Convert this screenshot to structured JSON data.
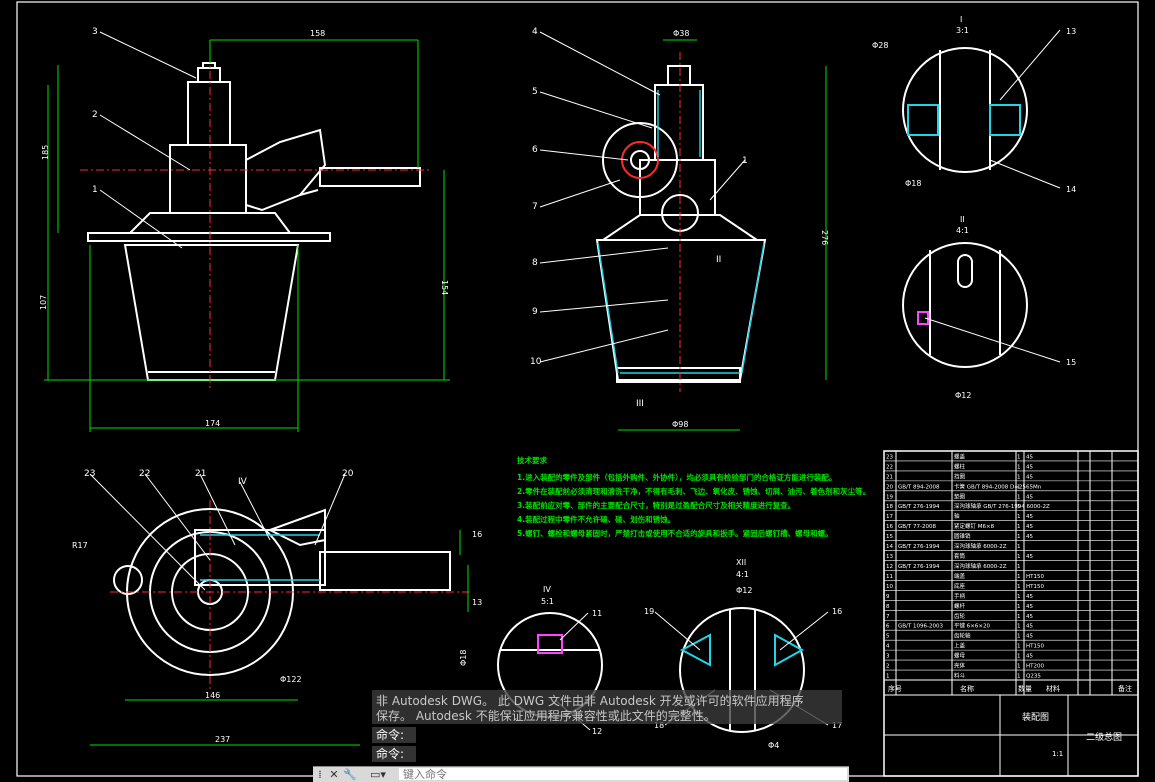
{
  "drawing": {
    "dimensions": {
      "d1": "158",
      "d2": "185",
      "d3": "107",
      "d4": "174",
      "d5": "154",
      "d6": "Φ38",
      "d7": "276",
      "d8": "Φ98",
      "d9": "Φ28",
      "d10": "Φ18",
      "d11": "Φ12",
      "d12": "R17",
      "d13": "Φ122",
      "d14": "146",
      "d15": "237",
      "d16": "16",
      "d17": "13",
      "d18": "Φ18",
      "d19": "Φ12",
      "d20": "Φ4"
    },
    "balloons": [
      "3",
      "2",
      "1",
      "4",
      "5",
      "6",
      "7",
      "1",
      "8",
      "9",
      "10",
      "13",
      "14",
      "15",
      "23",
      "22",
      "21",
      "20",
      "11",
      "12",
      "19",
      "16",
      "18",
      "17"
    ],
    "views": {
      "detail_i": {
        "label": "I",
        "scale": "3:1"
      },
      "detail_ii": {
        "label": "II",
        "scale": "4:1"
      },
      "detail_ii_marker": "II",
      "detail_iii_marker": "III",
      "detail_iv": {
        "label": "IV",
        "scale": "5:1"
      },
      "detail_iv_marker": "IV",
      "detail_xii": {
        "label": "XII",
        "scale": "4:1"
      }
    },
    "notes": {
      "title": "技术要求",
      "lines": [
        "1.进入装配的零件及部件（包括外购件、外协件），均必须具有检验部门的合格证方能进行装配。",
        "2.零件在装配前必须清理和清洗干净，不得有毛刺、飞边、氧化皮、锈蚀、切屑、油污、着色剂和灰尘等。",
        "3.装配前应对零、部件的主要配合尺寸，特别是过盈配合尺寸及相关精度进行复查。",
        "4.装配过程中零件不允许磕、碰、划伤和锈蚀。",
        "5.螺钉、螺栓和螺母紧固时，严禁打击或使用不合适的旋具和扳手。紧固后螺钉槽、螺母和螺。"
      ]
    },
    "title_block": {
      "drawing_name": "装配图",
      "drawing_no": "二级总图",
      "header_cells": [
        "序号",
        "名称",
        "数量",
        "材料",
        "备注"
      ],
      "scale": "1:1",
      "parts_list": [
        {
          "no": "23",
          "code": "",
          "name": "螺盖",
          "qty": "1",
          "mat": "45"
        },
        {
          "no": "22",
          "code": "",
          "name": "螺柱",
          "qty": "1",
          "mat": "45"
        },
        {
          "no": "21",
          "code": "",
          "name": "挡圈",
          "qty": "1",
          "mat": "45"
        },
        {
          "no": "20",
          "code": "GB/T 894-2008",
          "name": "卡簧 GB/T 894-2008 D=25",
          "qty": "1",
          "mat": "65Mn"
        },
        {
          "no": "19",
          "code": "",
          "name": "垫圈",
          "qty": "1",
          "mat": "45"
        },
        {
          "no": "18",
          "code": "GB/T 276-1994",
          "name": "深沟球轴承 GB/T 276-1994 6000-2Z",
          "qty": "1",
          "mat": ""
        },
        {
          "no": "17",
          "code": "",
          "name": "轴",
          "qty": "1",
          "mat": "45"
        },
        {
          "no": "16",
          "code": "GB/T 77-2008",
          "name": "紧定螺钉 M6×8",
          "qty": "1",
          "mat": "45"
        },
        {
          "no": "15",
          "code": "",
          "name": "圆锥销",
          "qty": "1",
          "mat": "45"
        },
        {
          "no": "14",
          "code": "GB/T 276-1994",
          "name": "深沟球轴承 6000-2Z",
          "qty": "1",
          "mat": ""
        },
        {
          "no": "13",
          "code": "",
          "name": "套筒",
          "qty": "1",
          "mat": "45"
        },
        {
          "no": "12",
          "code": "GB/T 276-1994",
          "name": "深沟球轴承 6000-2Z",
          "qty": "1",
          "mat": ""
        },
        {
          "no": "11",
          "code": "",
          "name": "端盖",
          "qty": "1",
          "mat": "HT150"
        },
        {
          "no": "10",
          "code": "",
          "name": "底座",
          "qty": "1",
          "mat": "HT150"
        },
        {
          "no": "9",
          "code": "",
          "name": "手柄",
          "qty": "1",
          "mat": "45"
        },
        {
          "no": "8",
          "code": "",
          "name": "螺杆",
          "qty": "1",
          "mat": "45"
        },
        {
          "no": "7",
          "code": "",
          "name": "齿轮",
          "qty": "1",
          "mat": "45"
        },
        {
          "no": "6",
          "code": "GB/T 1096-2003",
          "name": "平键 6×6×20",
          "qty": "1",
          "mat": "45"
        },
        {
          "no": "5",
          "code": "",
          "name": "齿轮轴",
          "qty": "1",
          "mat": "45"
        },
        {
          "no": "4",
          "code": "",
          "name": "上盖",
          "qty": "1",
          "mat": "HT150"
        },
        {
          "no": "3",
          "code": "",
          "name": "螺母",
          "qty": "1",
          "mat": "45"
        },
        {
          "no": "2",
          "code": "",
          "name": "壳体",
          "qty": "1",
          "mat": "HT200"
        },
        {
          "no": "1",
          "code": "",
          "name": "料斗",
          "qty": "1",
          "mat": "Q235"
        }
      ]
    }
  },
  "command_line": {
    "message_line1": "非 Autodesk DWG。  此 DWG 文件由非 Autodesk 开发或许可的软件应用程序",
    "message_line2": "保存。 Autodesk 不能保证应用程序兼容性或此文件的完整性。",
    "history": [
      "命令:",
      "命令:"
    ],
    "placeholder": "键入命令"
  }
}
